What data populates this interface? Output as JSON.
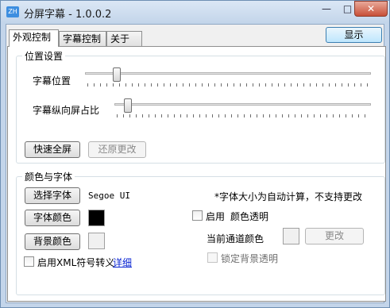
{
  "window": {
    "title": "分屏字幕 - 1.0.0.2",
    "app_icon": "ZH",
    "min_glyph": "—",
    "max_glyph": "□",
    "close_glyph": "✕"
  },
  "tabs": [
    {
      "label": "外观控制",
      "active": true
    },
    {
      "label": "字幕控制",
      "active": false
    },
    {
      "label": "关于",
      "active": false
    }
  ],
  "show_button": "显示",
  "position_group": {
    "legend": "位置设置",
    "subtitle_position_label": "字幕位置",
    "subtitle_position_value": 0.1,
    "vertical_ratio_label": "字幕纵向屏占比",
    "vertical_ratio_value": 0.05,
    "quick_fullscreen": "快速全屏",
    "restore_changes": "还原更改"
  },
  "color_group": {
    "legend": "颜色与字体",
    "select_font": "选择字体",
    "font_name": "Segoe UI",
    "font_size_note": "*字体大小为自动计算，不支持更改",
    "font_color": "字体颜色",
    "font_color_value": "#000000",
    "enable_color_transparency": "启用",
    "color_transparency": "颜色透明",
    "background_color": "背景颜色",
    "background_color_value": "#f0f0f0",
    "current_channel_color": "当前通道颜色",
    "change": "更改",
    "lock_background_transparency": "锁定背景透明",
    "enable_xml_escape": "启用XML符号转义",
    "details_link": "详细"
  }
}
